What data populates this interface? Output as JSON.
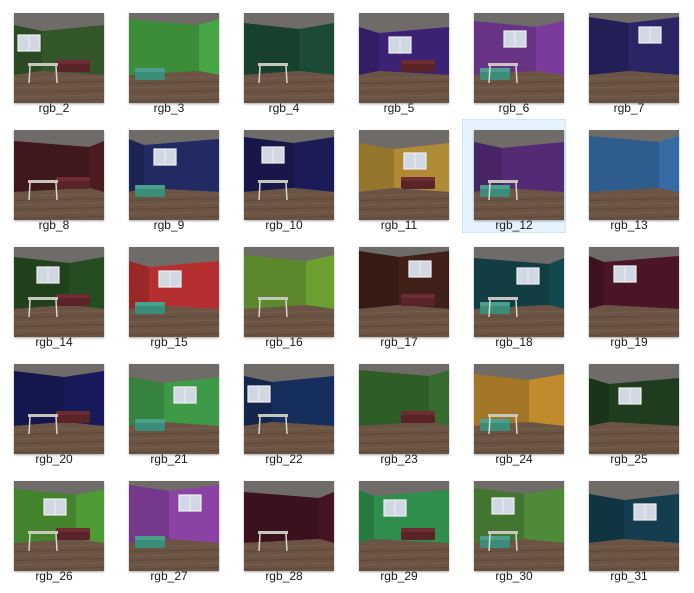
{
  "files": [
    {
      "label": "rgb_2",
      "wall": "#33572a",
      "scene": "green-corner"
    },
    {
      "label": "rgb_3",
      "wall": "#46a544",
      "scene": "green-sofa"
    },
    {
      "label": "rgb_4",
      "wall": "#1b4b35",
      "scene": "window-table"
    },
    {
      "label": "rgb_5",
      "wall": "#3c2274",
      "scene": "purple-room"
    },
    {
      "label": "rgb_6",
      "wall": "#7a3b9c",
      "scene": "purple-wall"
    },
    {
      "label": "rgb_7",
      "wall": "#2a2565",
      "scene": "navy-corner"
    },
    {
      "label": "rgb_8",
      "wall": "#4a1c20",
      "scene": "maroon-room"
    },
    {
      "label": "rgb_9",
      "wall": "#212a63",
      "scene": "navy-wide"
    },
    {
      "label": "rgb_10",
      "wall": "#1b1b57",
      "scene": "navy-window"
    },
    {
      "label": "rgb_11",
      "wall": "#b08a34",
      "scene": "gold-room"
    },
    {
      "label": "rgb_12",
      "wall": "#542a75",
      "scene": "purple-table",
      "selected": true
    },
    {
      "label": "rgb_13",
      "wall": "#366ca6",
      "scene": "blue-room"
    },
    {
      "label": "rgb_14",
      "wall": "#264c21",
      "scene": "green-window"
    },
    {
      "label": "rgb_15",
      "wall": "#b52f30",
      "scene": "red-room"
    },
    {
      "label": "rgb_16",
      "wall": "#6ba031",
      "scene": "lime-room"
    },
    {
      "label": "rgb_17",
      "wall": "#402018",
      "scene": "brown-room"
    },
    {
      "label": "rgb_18",
      "wall": "#14484f",
      "scene": "teal-room"
    },
    {
      "label": "rgb_19",
      "wall": "#4a1527",
      "scene": "wine-room"
    },
    {
      "label": "rgb_20",
      "wall": "#181a5c",
      "scene": "navy-sofa"
    },
    {
      "label": "rgb_21",
      "wall": "#3e9a48",
      "scene": "green-chair"
    },
    {
      "label": "rgb_22",
      "wall": "#162e5b",
      "scene": "navy-table"
    },
    {
      "label": "rgb_23",
      "wall": "#366d2f",
      "scene": "green-table"
    },
    {
      "label": "rgb_24",
      "wall": "#c08a2d",
      "scene": "orange-room"
    },
    {
      "label": "rgb_25",
      "wall": "#1f3d1e",
      "scene": "dark-green"
    },
    {
      "label": "rgb_26",
      "wall": "#4e9a34",
      "scene": "green-desk"
    },
    {
      "label": "rgb_27",
      "wall": "#8b42a5",
      "scene": "purple-sofa"
    },
    {
      "label": "rgb_28",
      "wall": "#471423",
      "scene": "wine-sofa"
    },
    {
      "label": "rgb_29",
      "wall": "#2f8e4c",
      "scene": "green-empty"
    },
    {
      "label": "rgb_30",
      "wall": "#4e8a38",
      "scene": "green-chair2"
    },
    {
      "label": "rgb_31",
      "wall": "#143d4f",
      "scene": "teal-sofa"
    }
  ],
  "colors": {
    "ceiling": "#6e6b68",
    "floor": "#6b5444",
    "selection_fill": "#e5f3ff",
    "selection_border": "#cce8ff"
  }
}
